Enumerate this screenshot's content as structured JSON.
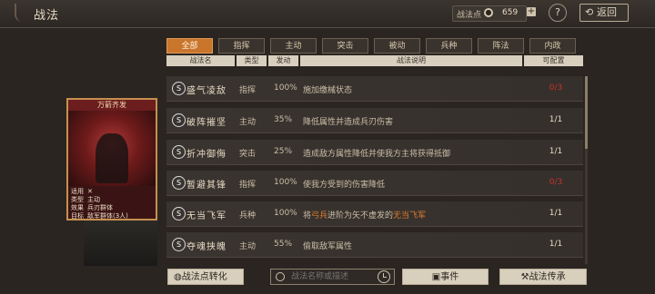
{
  "header": {
    "title": "战法",
    "points_label": "战法点",
    "points_icon": "coin-icon",
    "points_value": "659",
    "plus_label": "+",
    "help_label": "?",
    "back_label": "返回"
  },
  "tabs": [
    "全部",
    "指挥",
    "主动",
    "突击",
    "被动",
    "兵种",
    "阵法",
    "内政"
  ],
  "active_tab": "全部",
  "columns": [
    "战法名",
    "类型",
    "发动",
    "战法说明",
    "可配置"
  ],
  "rows": [
    {
      "icon": "S",
      "name": "盛气凌敌",
      "type": "指挥",
      "rate": "100%",
      "desc": "施加缴械状态",
      "cap": "0/3",
      "cap_color": "#c8322b"
    },
    {
      "icon": "S",
      "name": "破阵摧坚",
      "type": "主动",
      "rate": "35%",
      "desc": "降低属性并造成兵刃伤害",
      "cap": "1/1"
    },
    {
      "icon": "S",
      "name": "折冲御侮",
      "type": "突击",
      "rate": "25%",
      "desc": "造成敌方属性降低并使我方主将获得抵御",
      "cap": "1/1"
    },
    {
      "icon": "S",
      "name": "暂避其锋",
      "type": "指挥",
      "rate": "100%",
      "desc": "使我方受到的伤害降低",
      "cap": "0/3",
      "cap_color": "#c8322b"
    },
    {
      "icon": "S",
      "name": "无当飞军",
      "type": "兵种",
      "rate": "100%",
      "desc_pre": "将",
      "desc_hl1": "弓兵",
      "desc_mid": "进阶为矢不虚发的",
      "desc_hl2": "无当飞军",
      "cap": "1/1"
    },
    {
      "icon": "S",
      "name": "夺魂挟魄",
      "type": "主动",
      "rate": "55%",
      "desc": "偷取敌军属性",
      "cap": "1/1"
    }
  ],
  "card": {
    "title": "万箭齐发",
    "stats": [
      {
        "k": "适用",
        "v": "✕"
      },
      {
        "k": "类型",
        "v": "主动"
      },
      {
        "k": "效果",
        "v": "兵刃群体"
      },
      {
        "k": "目标",
        "v": "敌军群体(3人)"
      }
    ]
  },
  "footer": {
    "convert_label": "战法点转化",
    "search_placeholder": "战法名称或描述",
    "event_label": "事件",
    "inherit_label": "战法传承"
  },
  "colors": {
    "accent": "#c9752b",
    "highlight": "#e07b2e",
    "unavailable": "#c8322b"
  }
}
